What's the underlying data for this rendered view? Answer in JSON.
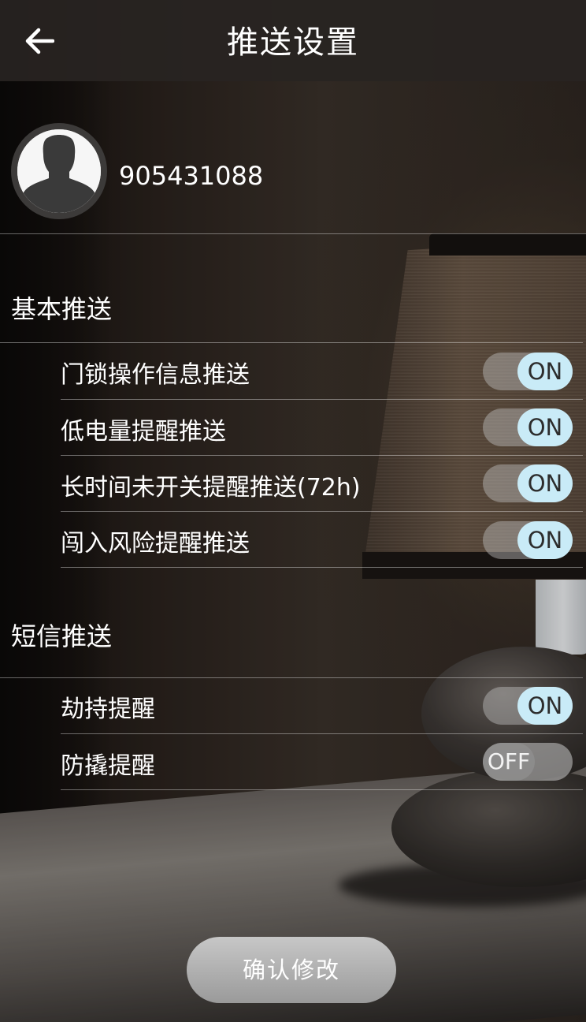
{
  "header": {
    "title": "推送设置",
    "back_icon": "arrow-left-icon"
  },
  "profile": {
    "username": "905431088",
    "avatar_icon": "user-silhouette-icon"
  },
  "sections": [
    {
      "title": "基本推送",
      "items": [
        {
          "label": "门锁操作信息推送",
          "state": "ON"
        },
        {
          "label": "低电量提醒推送",
          "state": "ON"
        },
        {
          "label": "长时间未开关提醒推送(72h)",
          "state": "ON"
        },
        {
          "label": "闯入风险提醒推送",
          "state": "ON"
        }
      ]
    },
    {
      "title": "短信推送",
      "items": [
        {
          "label": "劫持提醒",
          "state": "ON"
        },
        {
          "label": "防撬提醒",
          "state": "OFF"
        }
      ]
    }
  ],
  "confirm_label": "确认修改",
  "colors": {
    "toggle_on_knob": "#c9ebf7",
    "header_bg": "#282422",
    "confirm_bg": "#b5b5b5"
  }
}
